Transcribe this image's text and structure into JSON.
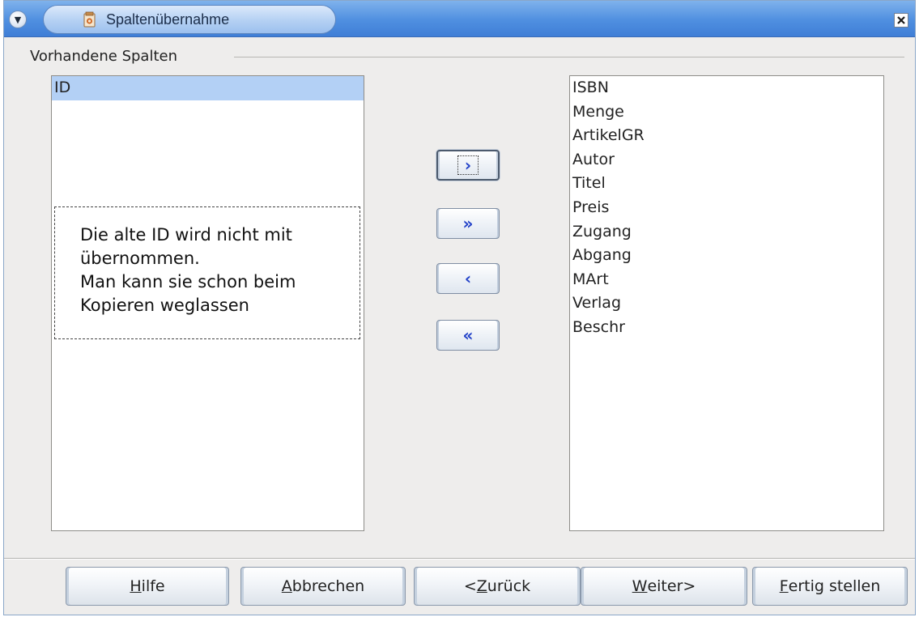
{
  "window": {
    "title": "Spaltenübernahme",
    "close_glyph": "×"
  },
  "group": {
    "label": "Vorhandene Spalten"
  },
  "left_list": {
    "items": [
      {
        "label": "ID",
        "selected": true
      }
    ]
  },
  "right_list": {
    "items": [
      "ISBN",
      "Menge",
      "ArtikelGR",
      "Autor",
      "Titel",
      "Preis",
      "Zugang",
      "Abgang",
      "MArt",
      "Verlag",
      "Beschr"
    ]
  },
  "annotation": {
    "lines": [
      "Die alte ID wird nicht mit",
      "übernommen.",
      "Man kann sie schon beim",
      "Kopieren weglassen"
    ]
  },
  "transfer_buttons": {
    "move_selected": "›",
    "move_all": "»",
    "remove_selected": "‹",
    "remove_all": "«"
  },
  "buttons": {
    "help": {
      "mnemonic": "H",
      "rest": "ilfe"
    },
    "cancel": {
      "mnemonic": "A",
      "rest": "bbrechen"
    },
    "back": {
      "prefix": "<",
      "mnemonic": "Z",
      "rest": "urück"
    },
    "next": {
      "mnemonic": "W",
      "rest": "eiter>"
    },
    "finish": {
      "mnemonic": "F",
      "rest": "ertig stellen"
    }
  }
}
